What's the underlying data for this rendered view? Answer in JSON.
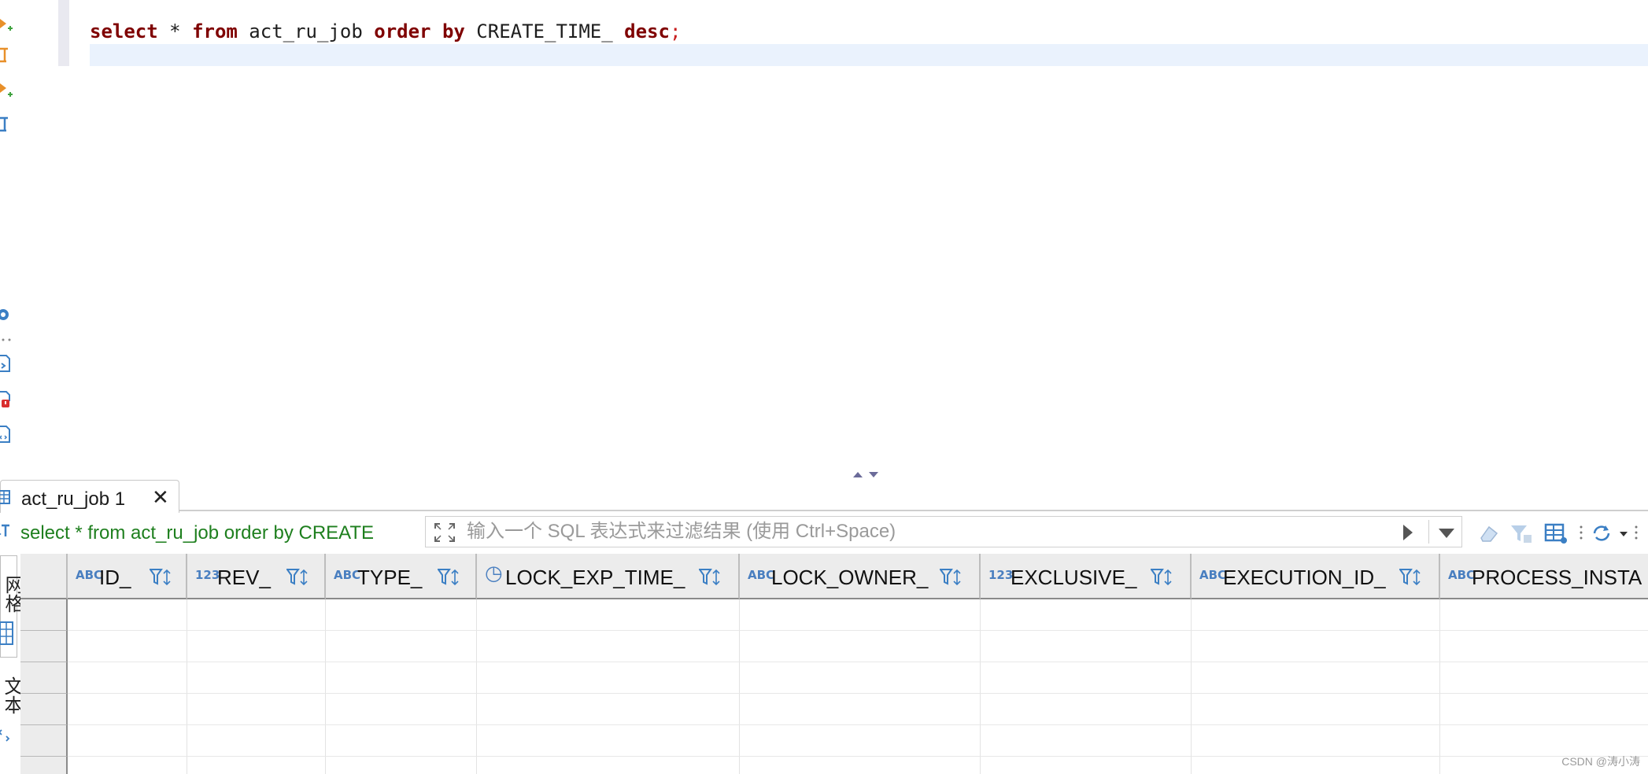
{
  "editor": {
    "sql_tokens": [
      {
        "text": "select",
        "kind": "kw"
      },
      {
        "text": " * ",
        "kind": "plain"
      },
      {
        "text": "from",
        "kind": "kw"
      },
      {
        "text": " act_ru_job ",
        "kind": "plain"
      },
      {
        "text": "order",
        "kind": "kw"
      },
      {
        "text": " ",
        "kind": "plain"
      },
      {
        "text": "by",
        "kind": "kw"
      },
      {
        "text": " CREATE_TIME_ ",
        "kind": "plain"
      },
      {
        "text": "desc",
        "kind": "kw"
      },
      {
        "text": ";",
        "kind": "semi"
      }
    ]
  },
  "result_tab": {
    "label": "act_ru_job 1",
    "close": "✕"
  },
  "filter_bar": {
    "sql_text": "select * from act_ru_job order by CREATE",
    "placeholder": "输入一个 SQL 表达式来过滤结果 (使用 Ctrl+Space)"
  },
  "side_tabs": {
    "grid": "网格",
    "text": "文本"
  },
  "columns": [
    {
      "type": "ABC",
      "name": "ID_",
      "icon": "key-string-icon"
    },
    {
      "type": "123",
      "name": "REV_",
      "icon": "number-icon"
    },
    {
      "type": "ABC",
      "name": "TYPE_",
      "icon": "string-icon"
    },
    {
      "type": "◷",
      "name": "LOCK_EXP_TIME_",
      "icon": "clock-icon"
    },
    {
      "type": "ABC",
      "name": "LOCK_OWNER_",
      "icon": "string-icon"
    },
    {
      "type": "123",
      "name": "EXCLUSIVE_",
      "icon": "number-icon"
    },
    {
      "type": "ABC",
      "name": "EXECUTION_ID_",
      "icon": "foreign-key-string-icon"
    },
    {
      "type": "ABC",
      "name": "PROCESS_INSTA",
      "icon": "foreign-key-string-icon"
    }
  ],
  "empty_rows": 6,
  "watermark": "CSDN @涛小涛",
  "colors": {
    "keyword": "#7f0000",
    "sql_green": "#1e7f1e",
    "accent_blue": "#4a7fc0",
    "orange": "#e8902a"
  }
}
